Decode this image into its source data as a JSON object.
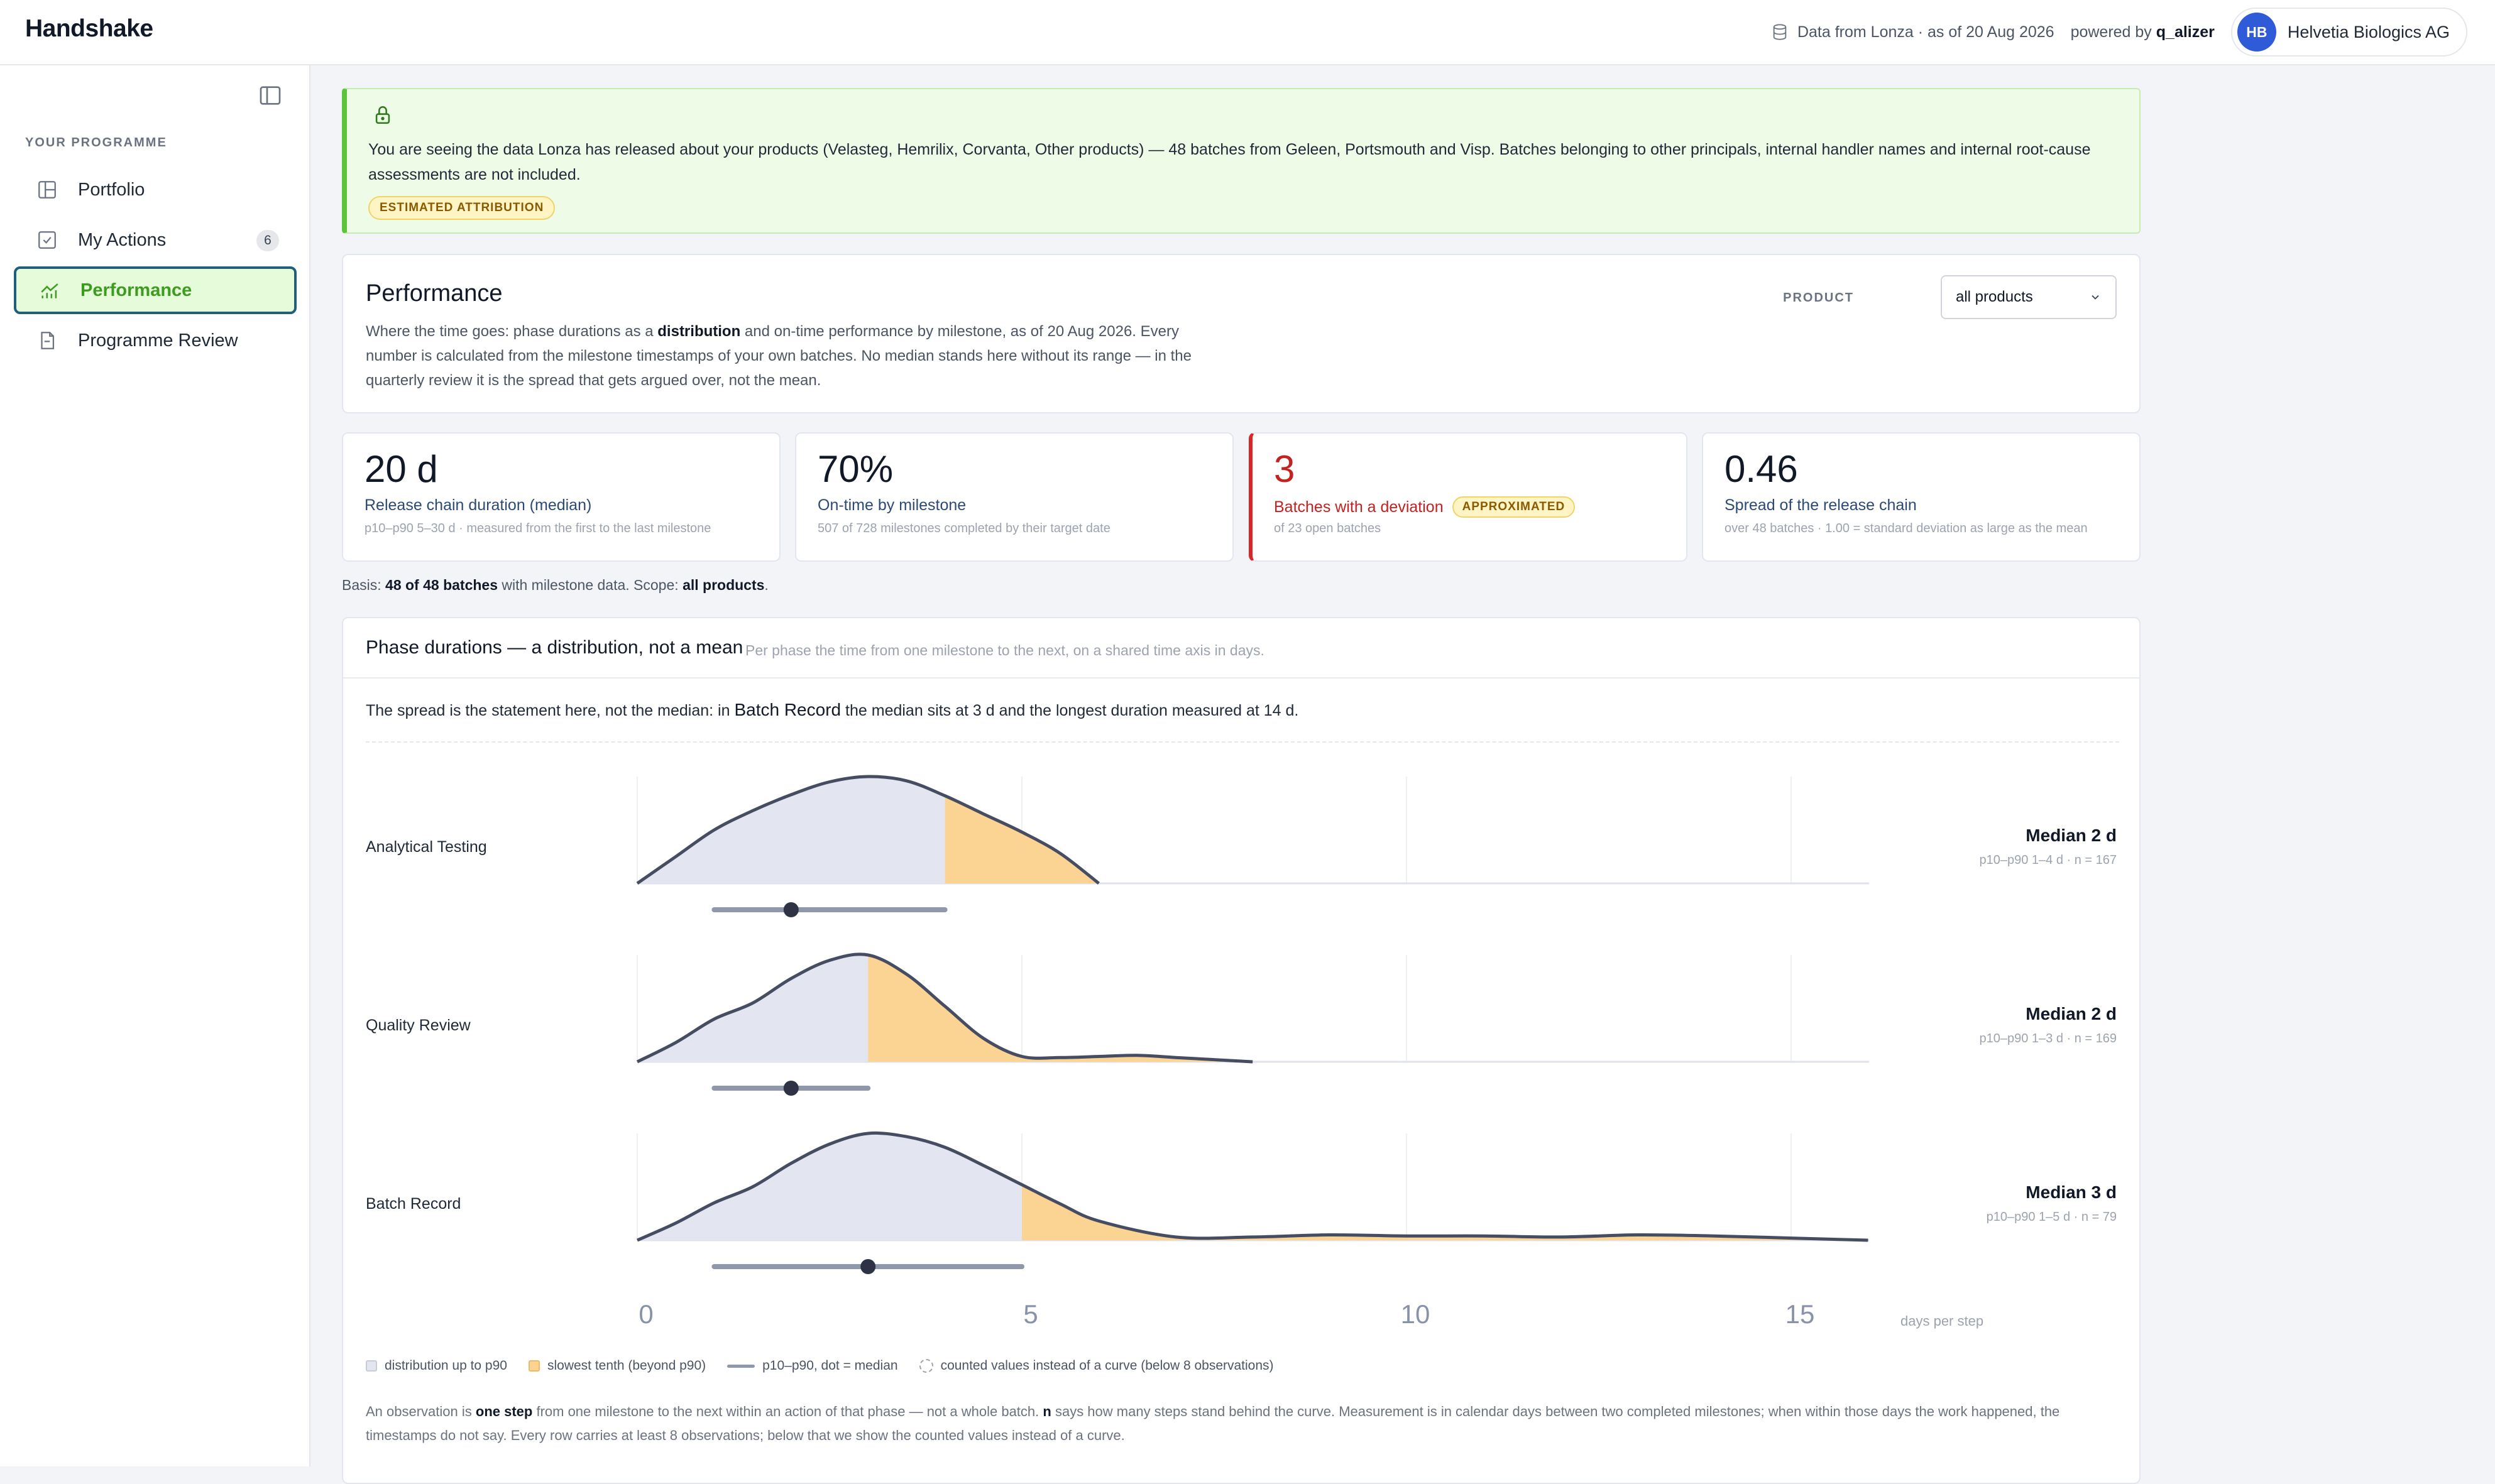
{
  "app": {
    "brand": "Handshake",
    "source_text": "Data from Lonza · as of 20 Aug 2026",
    "powered_prefix": "powered by",
    "powered_name": "q_alizer",
    "org_initials": "HB",
    "org_name": "Helvetia Biologics AG"
  },
  "sidebar": {
    "section_label": "YOUR PROGRAMME",
    "items": [
      {
        "label": "Portfolio",
        "icon": "layout-icon"
      },
      {
        "label": "My Actions",
        "icon": "checkbox-icon",
        "badge": "6"
      },
      {
        "label": "Performance",
        "icon": "chart-icon",
        "active": true
      },
      {
        "label": "Programme Review",
        "icon": "document-icon"
      }
    ]
  },
  "banner": {
    "text": "You are seeing the data Lonza has released about your products (Velasteg, Hemrilix, Corvanta, Other products) — 48 batches from Geleen, Portsmouth and Visp. Batches belonging to other principals, internal handler names and internal root-cause assessments are not included.",
    "pill": "ESTIMATED ATTRIBUTION"
  },
  "performance": {
    "title": "Performance",
    "desc_1": "Where the time goes: phase durations as a ",
    "desc_bold": "distribution",
    "desc_2": " and on-time performance by milestone, as of 20 Aug 2026. Every number is calculated from the milestone timestamps of your own batches. No median stands here without its range — in the quarterly review it is the spread that gets argued over, not the mean.",
    "product_label": "PRODUCT",
    "product_value": "all products"
  },
  "kpis": [
    {
      "value": "20 d",
      "label": "Release chain duration (median)",
      "sub": "p10–p90 5–30 d · measured from the first to the last milestone"
    },
    {
      "value": "70%",
      "label": "On-time by milestone",
      "sub": "507 of 728 milestones completed by their target date"
    },
    {
      "value": "3",
      "label": "Batches with a deviation",
      "pill": "APPROXIMATED",
      "sub": "of 23 open batches"
    },
    {
      "value": "0.46",
      "label": "Spread of the release chain",
      "sub": "over 48 batches · 1.00 = standard deviation as large as the mean"
    }
  ],
  "basis": {
    "prefix": "Basis: ",
    "count": "48 of 48 batches",
    "middle": " with milestone data. Scope: ",
    "scope": "all products",
    "end": "."
  },
  "distribution": {
    "title": "Phase durations — a distribution, not a mean",
    "subtitle": "Per phase the time from one milestone to the next, on a shared time axis in days.",
    "insight_1": "The spread is the statement here, not the median: in ",
    "insight_bold": "Batch Record",
    "insight_2": " the median sits at 3 d and the longest duration measured at 14 d.",
    "axis_unit": "days per step",
    "legend": [
      "distribution up to p90",
      "slowest tenth (beyond p90)",
      "p10–p90, dot = median",
      "counted values instead of a curve (below 8 observations)"
    ],
    "footnote_1": "An observation is ",
    "footnote_bold1": "one step",
    "footnote_2": " from one milestone to the next within an action of that phase — not a whole batch. ",
    "footnote_bold2": "n",
    "footnote_3": " says how many steps stand behind the curve. Measurement is in calendar days between two completed milestones; when within those days the work happened, the timestamps do not say. Every row carries at least 8 observations; below that we show the counted values instead of a curve."
  },
  "chart_data": {
    "type": "violin",
    "x_axis": {
      "ticks": [
        0,
        5,
        10,
        15
      ],
      "range": [
        0,
        16
      ],
      "unit": "days per step"
    },
    "colors": {
      "body": "#e3e6f0",
      "tail": "#fbd494",
      "outline": "#464d62",
      "range": "#8f97aa",
      "dot": "#2d3344"
    },
    "series": [
      {
        "name": "Analytical Testing",
        "median_label": "Median 2 d",
        "stats_label": "p10–p90 1–4 d · n = 167",
        "median": 2,
        "p10": 1,
        "p90": 4,
        "max": 6,
        "density": [
          [
            0,
            0
          ],
          [
            0.5,
            0.25
          ],
          [
            1,
            0.5
          ],
          [
            1.5,
            0.68
          ],
          [
            2,
            0.83
          ],
          [
            2.5,
            0.95
          ],
          [
            3,
            1.0
          ],
          [
            3.5,
            0.96
          ],
          [
            4,
            0.82
          ],
          [
            4.5,
            0.65
          ],
          [
            5,
            0.48
          ],
          [
            5.5,
            0.28
          ],
          [
            6,
            0
          ]
        ]
      },
      {
        "name": "Quality Review",
        "median_label": "Median 2 d",
        "stats_label": "p10–p90 1–3 d · n = 169",
        "median": 2,
        "p10": 1,
        "p90": 3,
        "max": 8,
        "density": [
          [
            0,
            0
          ],
          [
            0.5,
            0.18
          ],
          [
            1,
            0.4
          ],
          [
            1.5,
            0.55
          ],
          [
            2,
            0.78
          ],
          [
            2.5,
            0.95
          ],
          [
            3,
            1.0
          ],
          [
            3.5,
            0.82
          ],
          [
            4,
            0.52
          ],
          [
            4.5,
            0.22
          ],
          [
            5,
            0.05
          ],
          [
            5.5,
            0.04
          ],
          [
            6,
            0.05
          ],
          [
            6.5,
            0.06
          ],
          [
            7,
            0.04
          ],
          [
            7.5,
            0.02
          ],
          [
            8,
            0
          ]
        ]
      },
      {
        "name": "Batch Record",
        "median_label": "Median 3 d",
        "stats_label": "p10–p90 1–5 d · n = 79",
        "median": 3,
        "p10": 1,
        "p90": 5,
        "max": 16,
        "density": [
          [
            0,
            0
          ],
          [
            0.5,
            0.16
          ],
          [
            1,
            0.35
          ],
          [
            1.5,
            0.5
          ],
          [
            2,
            0.72
          ],
          [
            2.5,
            0.9
          ],
          [
            3,
            1.0
          ],
          [
            3.5,
            0.97
          ],
          [
            4,
            0.87
          ],
          [
            4.5,
            0.7
          ],
          [
            5,
            0.52
          ],
          [
            5.5,
            0.34
          ],
          [
            6,
            0.18
          ],
          [
            7,
            0.03
          ],
          [
            8,
            0.03
          ],
          [
            9,
            0.05
          ],
          [
            10,
            0.04
          ],
          [
            11,
            0.04
          ],
          [
            12,
            0.03
          ],
          [
            13,
            0.05
          ],
          [
            14,
            0.04
          ],
          [
            15,
            0.02
          ],
          [
            16,
            0
          ]
        ]
      }
    ]
  }
}
